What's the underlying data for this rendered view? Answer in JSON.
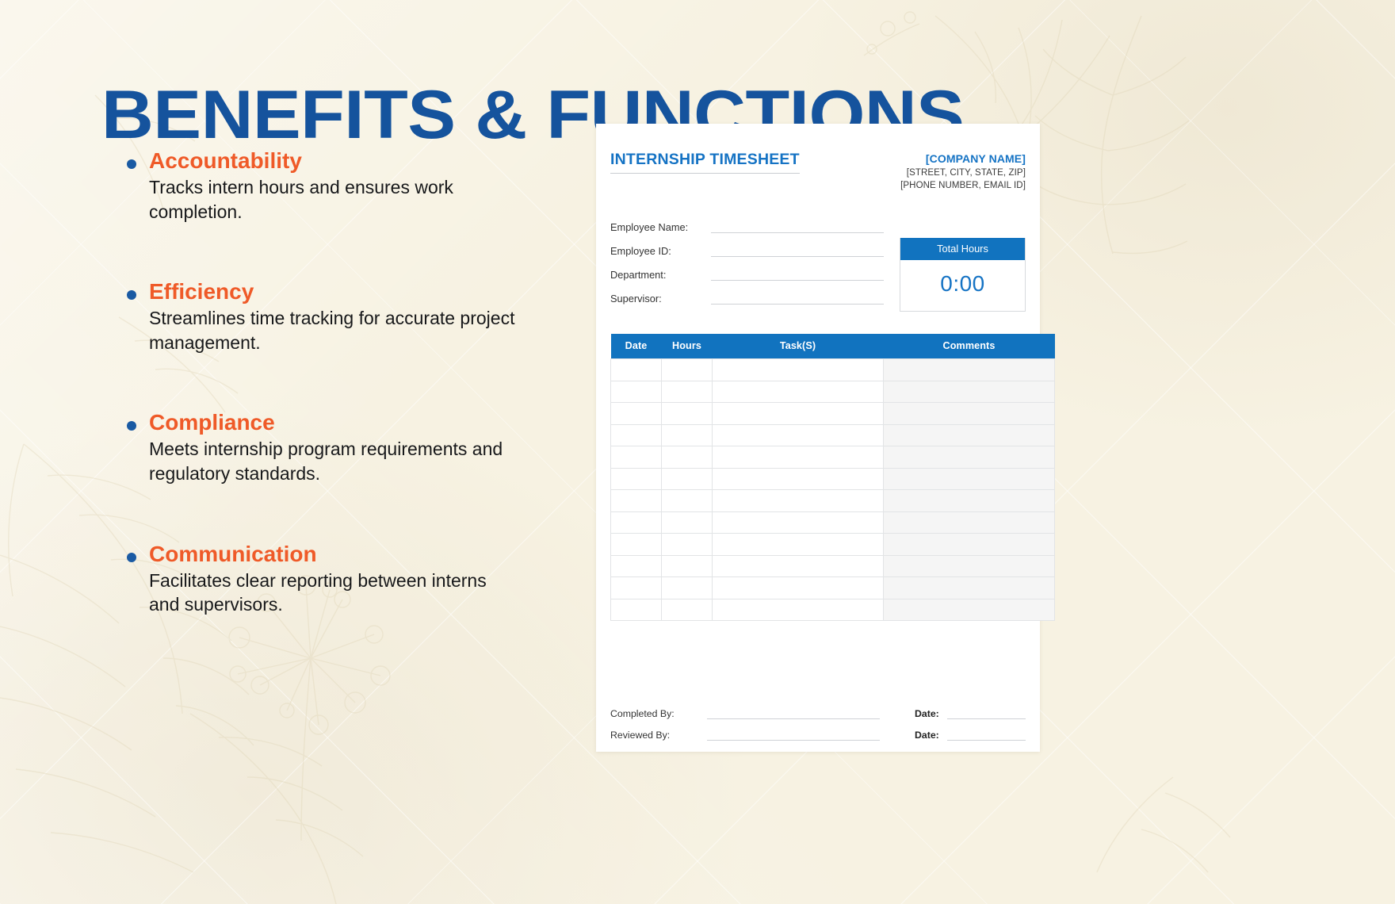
{
  "slide": {
    "title": "BENEFITS & FUNCTIONS",
    "accent_blue": "#15539d",
    "accent_orange": "#ef5a28",
    "background": "#f7f2e2"
  },
  "benefits": [
    {
      "heading": "Accountability",
      "description": "Tracks intern hours and ensures work completion."
    },
    {
      "heading": "Efficiency",
      "description": "Streamlines time tracking for accurate project management."
    },
    {
      "heading": "Compliance",
      "description": "Meets internship program requirements and regulatory standards."
    },
    {
      "heading": "Communication",
      "description": "Facilitates clear reporting between interns and supervisors."
    }
  ],
  "timesheet": {
    "title": "INTERNSHIP TIMESHEET",
    "company": {
      "name": "[COMPANY NAME]",
      "address": "[STREET, CITY, STATE, ZIP]",
      "contact": "[PHONE NUMBER, EMAIL ID]"
    },
    "fields": [
      {
        "label": "Employee Name:",
        "value": ""
      },
      {
        "label": "Employee ID:",
        "value": ""
      },
      {
        "label": "Department:",
        "value": ""
      },
      {
        "label": "Supervisor:",
        "value": ""
      }
    ],
    "total_hours": {
      "header": "Total Hours",
      "value": "0:00"
    },
    "table": {
      "columns": [
        "Date",
        "Hours",
        "Task(S)",
        "Comments"
      ],
      "rows": [
        [
          "",
          "",
          "",
          ""
        ],
        [
          "",
          "",
          "",
          ""
        ],
        [
          "",
          "",
          "",
          ""
        ],
        [
          "",
          "",
          "",
          ""
        ],
        [
          "",
          "",
          "",
          ""
        ],
        [
          "",
          "",
          "",
          ""
        ],
        [
          "",
          "",
          "",
          ""
        ],
        [
          "",
          "",
          "",
          ""
        ],
        [
          "",
          "",
          "",
          ""
        ],
        [
          "",
          "",
          "",
          ""
        ],
        [
          "",
          "",
          "",
          ""
        ],
        [
          "",
          "",
          "",
          ""
        ]
      ]
    },
    "footer": {
      "completed_by_label": "Completed By:",
      "reviewed_by_label": "Reviewed By:",
      "completed_date_label": "Date:",
      "reviewed_date_label": "Date:"
    },
    "header_color": "#1173bf",
    "title_color": "#1573c4"
  }
}
